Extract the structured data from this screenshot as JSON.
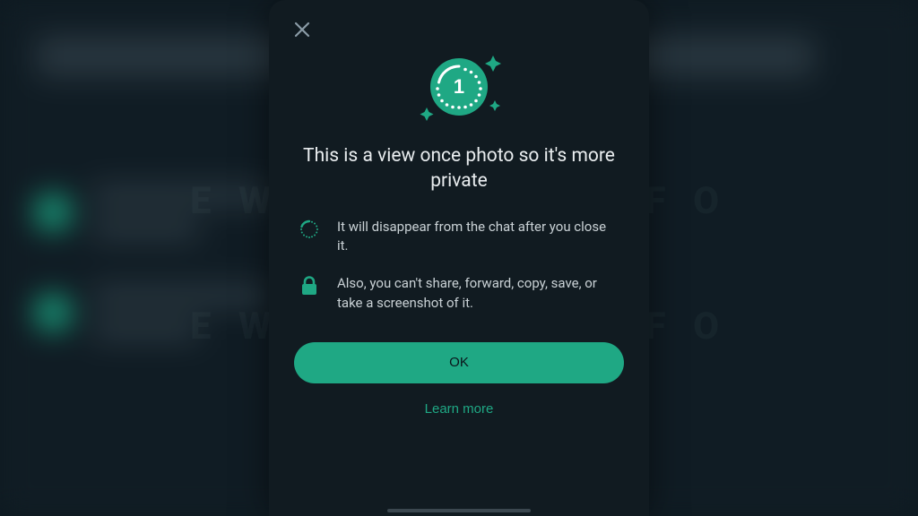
{
  "modal": {
    "title": "This is a view once photo so it's more private",
    "features": [
      {
        "text": "It will disappear from the chat after you close it."
      },
      {
        "text": "Also, you can't share, forward, copy, save, or take a screenshot of it."
      }
    ],
    "ok_label": "OK",
    "learn_more_label": "Learn more"
  },
  "colors": {
    "accent": "#1fa884"
  }
}
